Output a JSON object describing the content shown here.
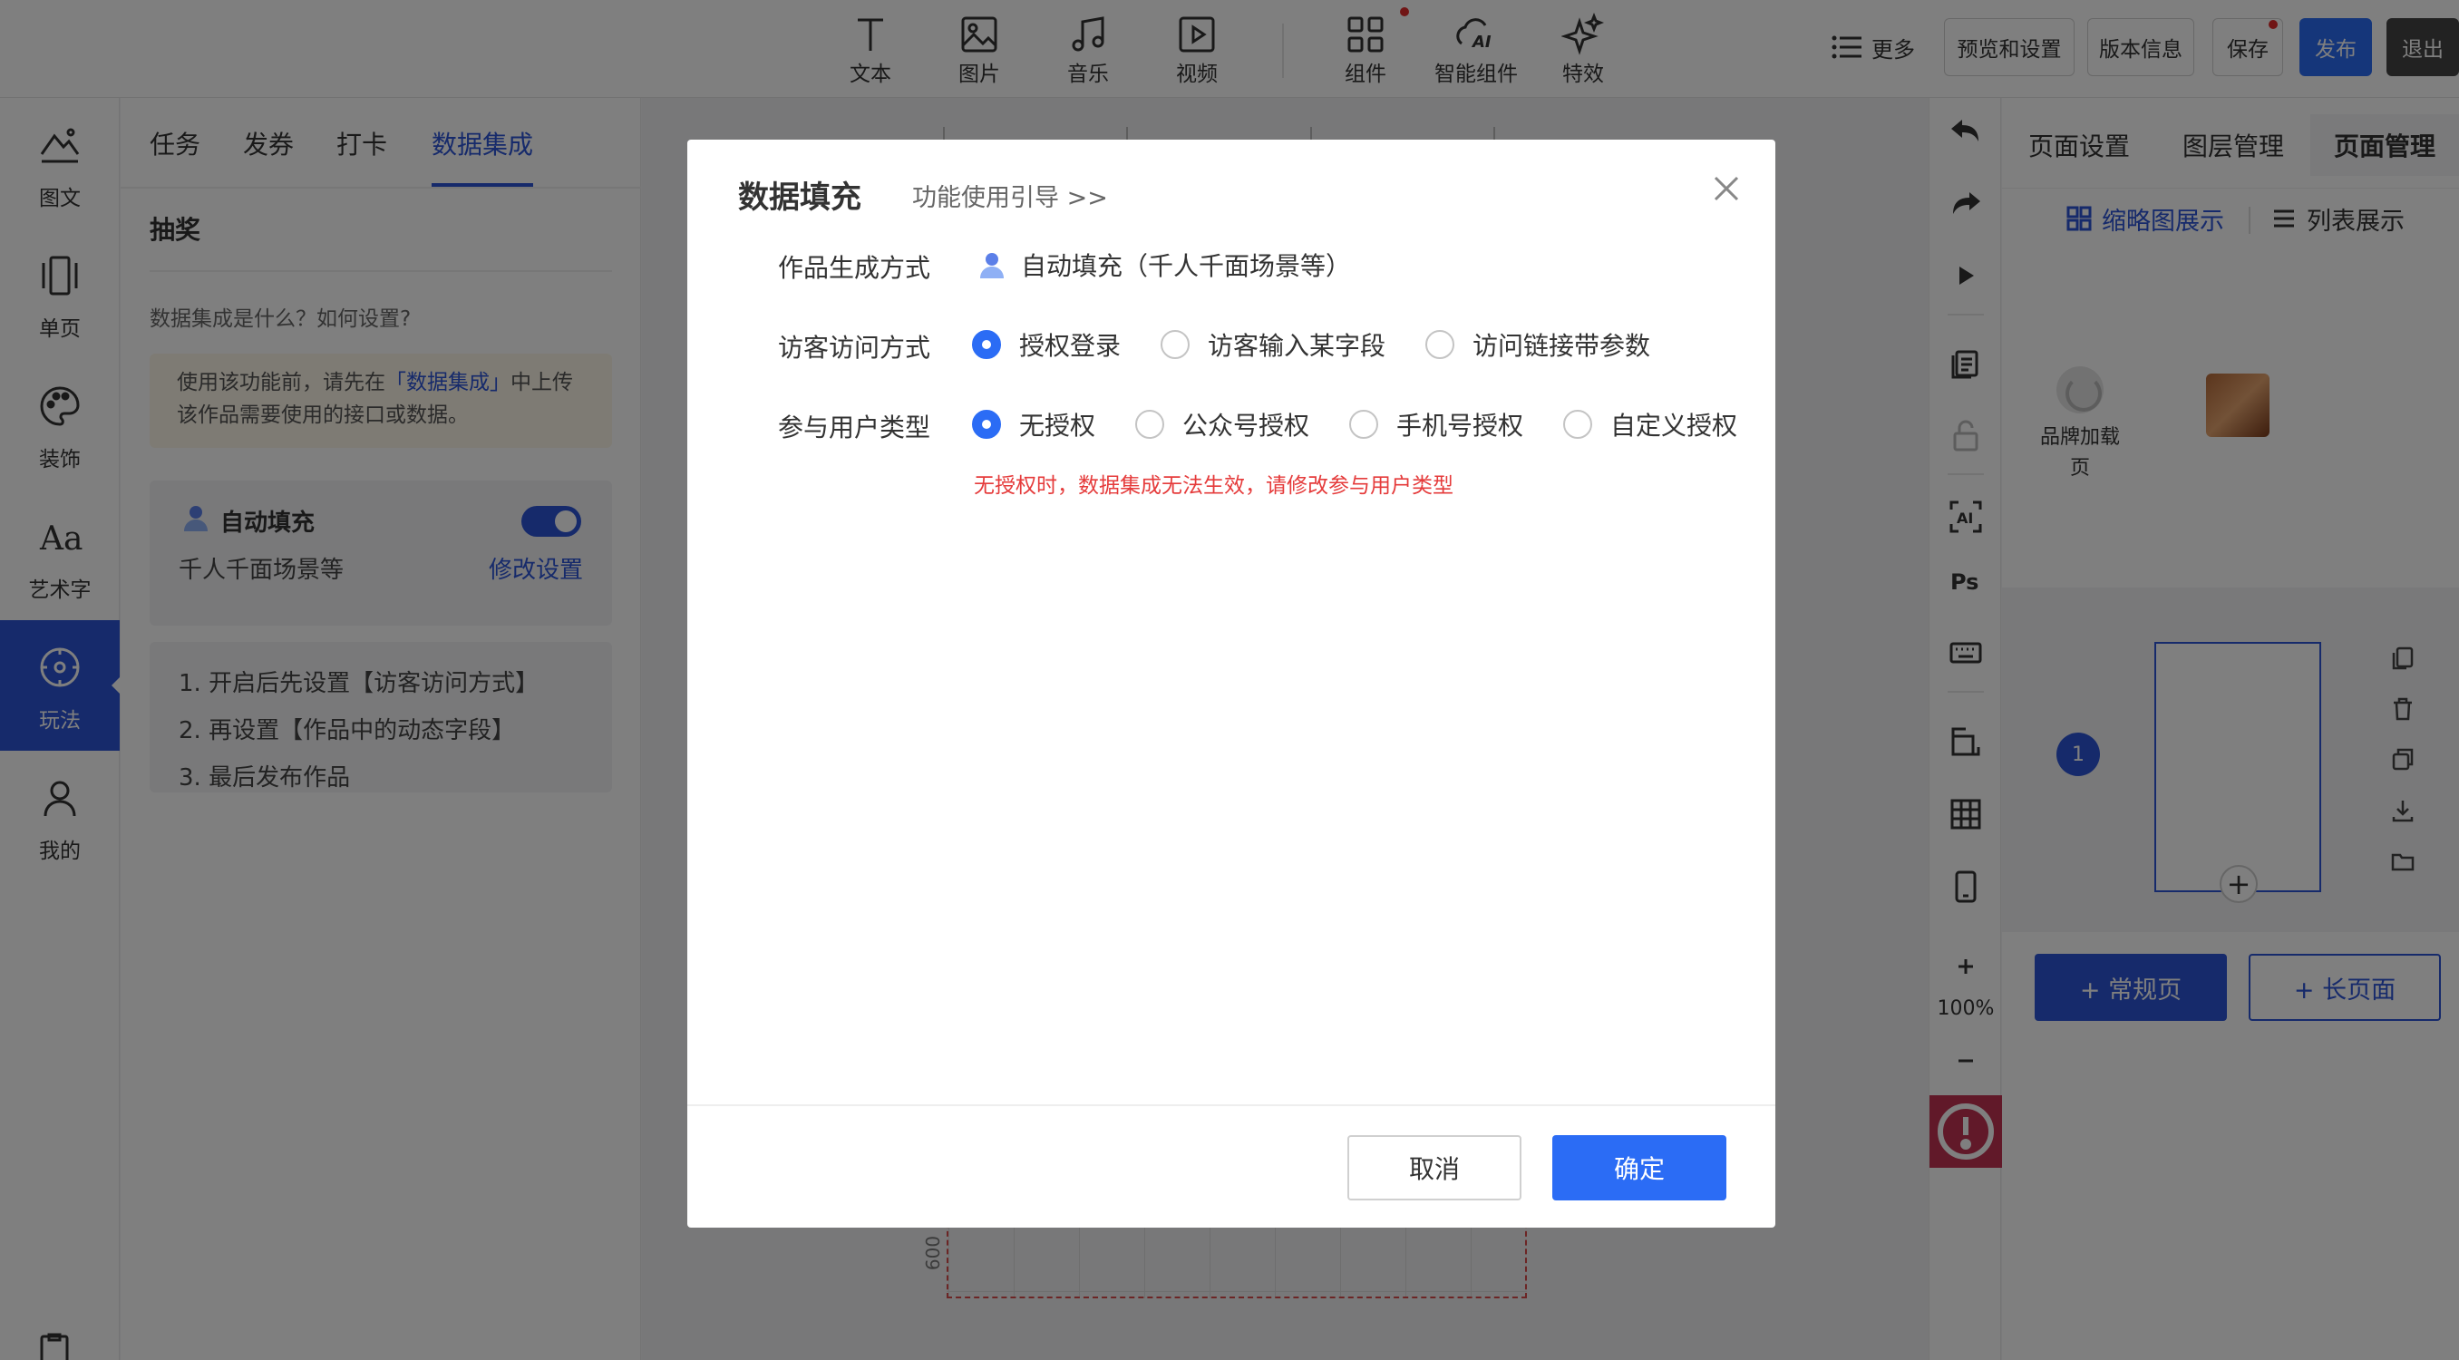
{
  "toolbar": {
    "tools": [
      {
        "label": "文本",
        "icon": "text-icon"
      },
      {
        "label": "图片",
        "icon": "image-icon"
      },
      {
        "label": "音乐",
        "icon": "music-icon"
      },
      {
        "label": "视频",
        "icon": "video-icon"
      },
      {
        "label": "组件",
        "icon": "components-icon"
      },
      {
        "label": "智能组件",
        "icon": "ai-components-icon"
      },
      {
        "label": "特效",
        "icon": "sparkle-icon"
      }
    ],
    "more_label": "更多",
    "preview_label": "预览和设置",
    "version_label": "版本信息",
    "save_label": "保存",
    "publish_label": "发布",
    "exit_label": "退出"
  },
  "leftnav": {
    "items": [
      {
        "label": "图文",
        "icon": "landscape-text-icon"
      },
      {
        "label": "单页",
        "icon": "single-page-icon"
      },
      {
        "label": "装饰",
        "icon": "palette-icon"
      },
      {
        "label": "艺术字",
        "icon": "art-text-icon"
      },
      {
        "label": "玩法",
        "icon": "compass-icon",
        "active": true
      },
      {
        "label": "我的",
        "icon": "user-icon"
      }
    ]
  },
  "leftpanel": {
    "tabs": [
      "任务",
      "发券",
      "打卡",
      "数据集成"
    ],
    "active_tab": "数据集成",
    "section_title": "抽奖",
    "help_text": "数据集成是什么？如何设置?",
    "notice_pre": "使用该功能前，请先在",
    "notice_link": "「数据集成」",
    "notice_post": "中上传该作品需要使用的接口或数据。",
    "card_title": "自动填充",
    "card_sub": "千人千面场景等",
    "card_link": "修改设置",
    "steps": [
      "1. 开启后先设置【访客访问方式】",
      "2. 再设置【作品中的动态字段】",
      "3. 最后发布作品"
    ]
  },
  "canvas": {
    "ruler_side_label": "600"
  },
  "righttools": {
    "zoom_label": "100%"
  },
  "rightpanel": {
    "tabs": [
      "页面设置",
      "图层管理",
      "页面管理"
    ],
    "active_tab": "页面管理",
    "view_thumb": "缩略图展示",
    "view_list": "列表展示",
    "loader_label": "品牌加载页",
    "page_number": "1",
    "add_normal": "+ 常规页",
    "add_long": "+ 长页面"
  },
  "modal": {
    "title": "数据填充",
    "guide": "功能使用引导 >>",
    "rows": {
      "gen_label": "作品生成方式",
      "gen_value": "自动填充（千人千面场景等）",
      "visit_label": "访客访问方式",
      "visit_options": [
        "授权登录",
        "访客输入某字段",
        "访问链接带参数"
      ],
      "visit_selected": 0,
      "user_label": "参与用户类型",
      "user_options": [
        "无授权",
        "公众号授权",
        "手机号授权",
        "自定义授权"
      ],
      "user_selected": 0
    },
    "warning": "无授权时，数据集成无法生效，请修改参与用户类型",
    "cancel": "取消",
    "ok": "确定"
  },
  "colors": {
    "accent": "#2b6cf5",
    "nav_active": "#2c55d6",
    "warning": "#e53b3b"
  }
}
